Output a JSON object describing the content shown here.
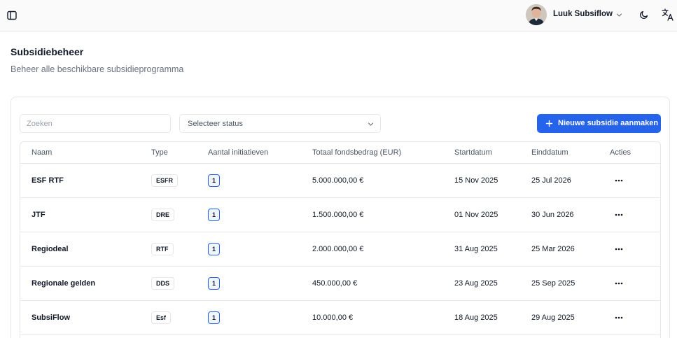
{
  "header": {
    "user_name": "Luuk Subsiflow",
    "icons": [
      "panel-left-icon",
      "chevron-down-icon",
      "moon-icon",
      "translate-icon"
    ]
  },
  "page": {
    "title": "Subsidiebeheer",
    "subtitle": "Beheer alle beschikbare subsidieprogramma"
  },
  "toolbar": {
    "search_placeholder": "Zoeken",
    "status_placeholder": "Selecteer status",
    "new_button_label": "Nieuwe subsidie aanmaken"
  },
  "table": {
    "columns": [
      "Naam",
      "Type",
      "Aantal initiatieven",
      "Totaal fondsbedrag (EUR)",
      "Startdatum",
      "Einddatum",
      "Acties"
    ],
    "rows": [
      {
        "name": "ESF RTF",
        "type": "ESFR",
        "count": "1",
        "total": "5.000.000,00 €",
        "start": "15 Nov 2025",
        "end": "25 Jul 2026"
      },
      {
        "name": "JTF",
        "type": "DRE",
        "count": "1",
        "total": "1.500.000,00 €",
        "start": "01 Nov 2025",
        "end": "30 Jun 2026"
      },
      {
        "name": "Regiodeal",
        "type": "RTF",
        "count": "1",
        "total": "2.000.000,00 €",
        "start": "31 Aug 2025",
        "end": "25 Mar 2026"
      },
      {
        "name": "Regionale gelden",
        "type": "DDS",
        "count": "1",
        "total": "450.000,00 €",
        "start": "23 Aug 2025",
        "end": "25 Sep 2025"
      },
      {
        "name": "SubsiFlow",
        "type": "Esf",
        "count": "1",
        "total": "10.000,00 €",
        "start": "18 Aug 2025",
        "end": "29 Aug 2025"
      }
    ]
  },
  "colors": {
    "accent": "#2563eb",
    "border": "#e5e7eb",
    "muted_text": "#6b7280",
    "topbar_bg": "#fafafa"
  }
}
